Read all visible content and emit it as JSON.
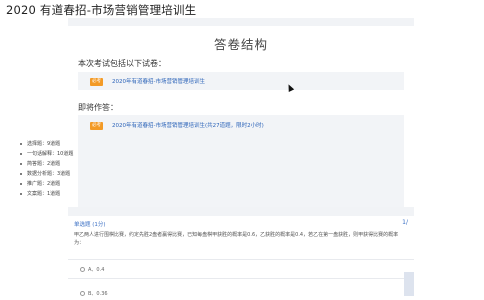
{
  "header": {
    "title": "2020 有道春招-市场营销管理培训生"
  },
  "structure": {
    "title": "答卷结构",
    "included_label": "本次考试包括以下试卷：",
    "included_exam": {
      "badge": "必考",
      "name": "2020年有道春招-市场营销管理培训生"
    },
    "current_label": "即将作答：",
    "current_exam": {
      "badge": "必考",
      "name": "2020年有道春招-市场营销管理培训生(共27道题，限时2小时)"
    },
    "question_types": [
      "选择题：9道题",
      "一句话解释：10道题",
      "简答题：2道题",
      "数据分析题：3道题",
      "推广题：2道题",
      "文案题：1道题"
    ]
  },
  "question": {
    "type_label": "单选题 (1分)",
    "counter": "1/",
    "text": "甲乙两人进行围棋比赛，约定先胜2盘者赢得比赛，已知每盘棋甲获胜的概率是0.6，乙获胜的概率是0.4，若乙在第一盘获胜，则甲获得比赛的概率为：",
    "options": [
      "A、0.4",
      "B、0.36"
    ]
  }
}
